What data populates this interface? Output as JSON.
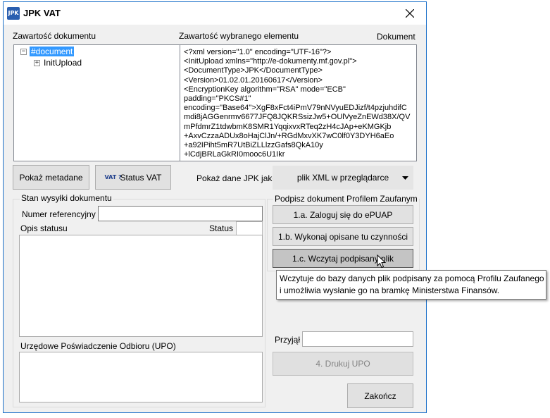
{
  "window": {
    "title": "JPK VAT",
    "icon_text": "JPK"
  },
  "labels": {
    "document_content": "Zawartość dokumentu",
    "selected_element_content": "Zawartość wybranego elementu",
    "document": "Dokument",
    "show_jpk_as": "Pokaż dane JPK jako:"
  },
  "tree": {
    "root": "#document",
    "child": "InitUpload"
  },
  "xml_lines": [
    "<?xml version=\"1.0\" encoding=\"UTF-16\"?>",
    "<InitUpload xmlns=\"http://e-dokumenty.mf.gov.pl\">",
    "<DocumentType>JPK</DocumentType>",
    "<Version>01.02.01.20160617</Version>",
    "<EncryptionKey algorithm=\"RSA\" mode=\"ECB\"",
    "padding=\"PKCS#1\"",
    "encoding=\"Base64\">XgF8xFct4iPmV79nNVyuEDJizf/t4pzjuhdifC",
    "mdi8jAGGenrmv6677JFQ8JQKRSsizJw5+OUlVyeZnEWd38X/QV",
    "mPfdmrZ1tdwbmK8SMR1YqqixvxRTeq2zH4cJAp+eKMGKjb",
    "+AxvCzzaADUx8oHajClJn/+RGdMxvXK7wC0lf0Y3DYH6aEo",
    "+a92IPiht5mR7UtBiZLLlzzGafs8QkA10y",
    "+lCdjBRLaGkRI0mooc6U1Ikr"
  ],
  "buttons": {
    "show_metadata": "Pokaż metadane",
    "status_vat": "Status VAT",
    "status_vat_icon": "VAT ?",
    "login_epuap": "1.a. Zaloguj się do ePUAP",
    "perform_described": "1.b. Wykonaj opisane tu czynności",
    "load_signed": "1.c. Wczytaj podpisany plik",
    "print_upo": "4. Drukuj UPO",
    "finish": "Zakończ"
  },
  "select": {
    "value": "plik XML w przeglądarce"
  },
  "send_status": {
    "group_title": "Stan wysyłki dokumentu",
    "reference_number_label": "Numer referencyjny",
    "reference_number_value": "",
    "status_description_header": "Opis statusu",
    "status_header": "Status",
    "upo_label": "Urzędowe Poświadczenie Odbioru (UPO)"
  },
  "sign": {
    "group_title": "Podpisz dokument Profilem Zaufanym"
  },
  "received": {
    "label": "Przyjął",
    "value": ""
  },
  "tooltip": {
    "line1": "Wczytuje do bazy danych plik podpisany za pomocą Profilu Zaufanego",
    "line2": "i umożliwia wysłanie go na bramkę Ministerstwa Finansów."
  },
  "colors": {
    "accent": "#3399ff",
    "border": "#1a6fc9"
  }
}
